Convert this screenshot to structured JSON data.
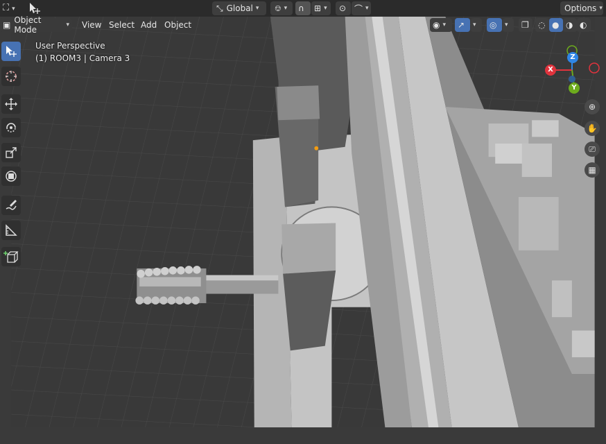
{
  "header": {
    "orientation_label": "Global",
    "options_label": "Options"
  },
  "mode_bar": {
    "mode_label": "Object Mode",
    "menus": [
      "View",
      "Select",
      "Add",
      "Object"
    ]
  },
  "viewport": {
    "perspective_label": "User Perspective",
    "object_label": "(1) ROOM3 | Camera 3"
  },
  "gizmo": {
    "x_label": "X",
    "y_label": "Y",
    "z_label": "Z",
    "colors": {
      "x": "#e0333d",
      "y": "#6dab1d",
      "z": "#2f86e6"
    }
  },
  "tools": [
    {
      "name": "select-box-tool",
      "active": true
    },
    {
      "name": "cursor-tool",
      "active": false
    },
    {
      "name": "move-tool",
      "active": false
    },
    {
      "name": "rotate-tool",
      "active": false
    },
    {
      "name": "scale-tool",
      "active": false
    },
    {
      "name": "transform-tool",
      "active": false
    },
    {
      "name": "annotate-tool",
      "active": false
    },
    {
      "name": "measure-tool",
      "active": false
    },
    {
      "name": "add-cube-tool",
      "active": false
    }
  ],
  "colors": {
    "accent": "#4772b3",
    "header_bg": "#2b2b2b",
    "viewport_bg": "#3a3a3a"
  }
}
